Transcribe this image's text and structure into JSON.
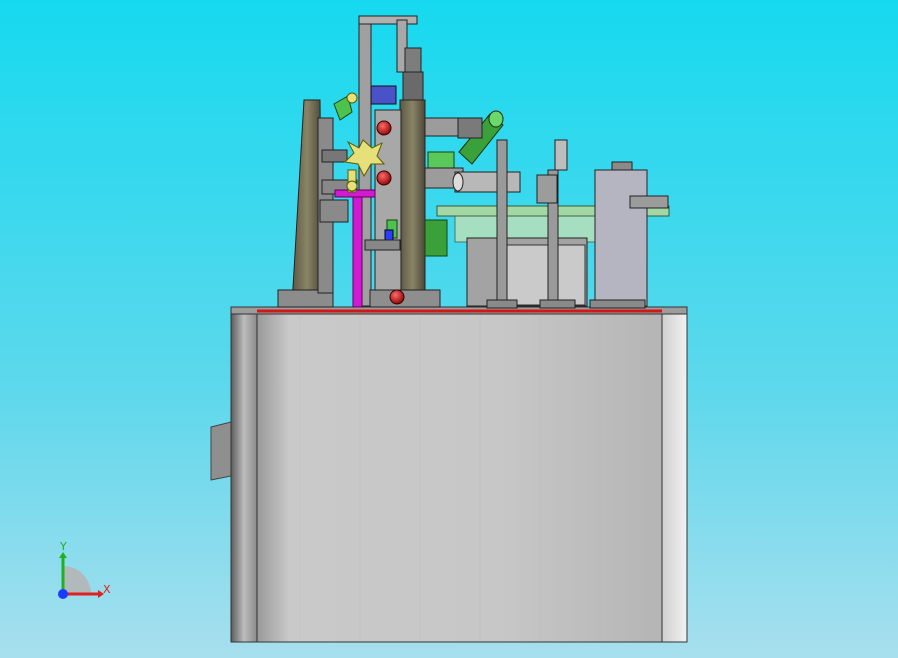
{
  "viewport": {
    "background_top": "#16d9ef",
    "background_bottom": "#a8dfee"
  },
  "axis_triad": {
    "x_label": "X",
    "y_label": "Y",
    "x_color": "#e02020",
    "y_color": "#20b020",
    "origin_color": "#1a3cff"
  },
  "model": {
    "cabinet_color": "#c8c8c8",
    "top_rail_color": "#d01818",
    "column_color": "#7a7458",
    "accent_green": "#4ec24e",
    "accent_magenta": "#d21ad2",
    "accent_yellow": "#e6e07a",
    "accent_blue": "#2a3cff",
    "handle_red": "#c21010",
    "plate_green": "#a9d8a2"
  }
}
